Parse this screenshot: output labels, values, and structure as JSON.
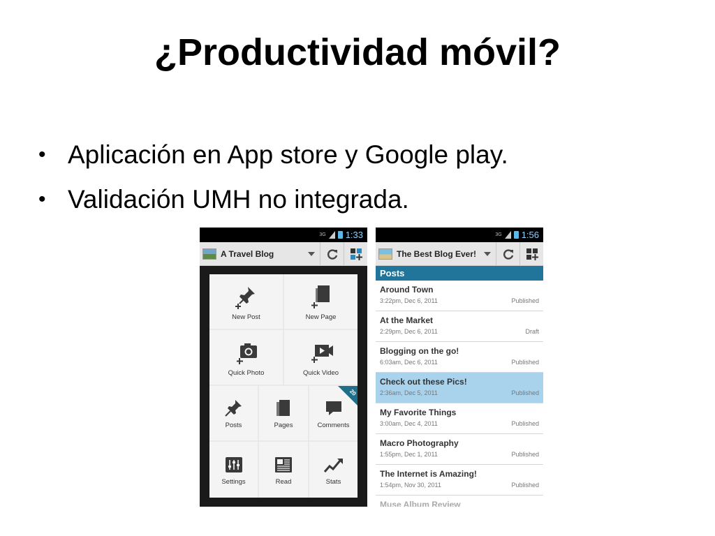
{
  "slide": {
    "title": "¿Productividad móvil?",
    "bullets": [
      "Aplicación en App store y Google play.",
      "Validación UMH no integrada."
    ],
    "bullet_glyph": "•"
  },
  "phone_a": {
    "status": {
      "network": "3G",
      "time": "1:33"
    },
    "blog_name": "A Travel Blog",
    "icons": {
      "refresh": "refresh-icon",
      "add": "add-content-icon"
    },
    "tiles_large": [
      "New Post",
      "New Page",
      "Quick Photo",
      "Quick Video"
    ],
    "tiles_small": [
      "Posts",
      "Pages",
      "Comments",
      "Settings",
      "Read",
      "Stats"
    ],
    "comments_badge": "20"
  },
  "phone_b": {
    "status": {
      "network": "3G",
      "time": "1:56"
    },
    "blog_name": "The Best Blog Ever!",
    "section": "Posts",
    "selected_index": 3,
    "posts": [
      {
        "title": "Around Town",
        "date": "3:22pm, Dec 6, 2011",
        "status": "Published"
      },
      {
        "title": "At the Market",
        "date": "2:29pm, Dec 6, 2011",
        "status": "Draft"
      },
      {
        "title": "Blogging on the go!",
        "date": "6:03am, Dec 6, 2011",
        "status": "Published"
      },
      {
        "title": "Check out these Pics!",
        "date": "2:36am, Dec 5, 2011",
        "status": "Published"
      },
      {
        "title": "My Favorite Things",
        "date": "3:00am, Dec 4, 2011",
        "status": "Published"
      },
      {
        "title": "Macro Photography",
        "date": "1:55pm, Dec 1, 2011",
        "status": "Published"
      },
      {
        "title": "The Internet is Amazing!",
        "date": "1:54pm, Nov 30, 2011",
        "status": "Published"
      },
      {
        "title": "Muse Album Review",
        "date": "",
        "status": ""
      }
    ]
  },
  "colors": {
    "accent": "#22759a",
    "selected_row": "#a9d3ec",
    "status_time": "#8fd3ff"
  }
}
